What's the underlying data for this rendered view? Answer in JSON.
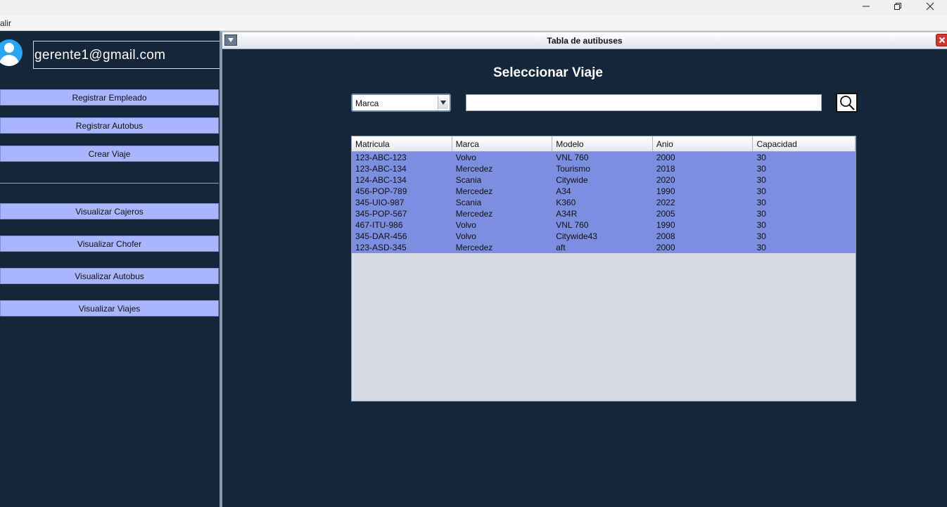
{
  "window": {
    "menu": [
      "alir"
    ]
  },
  "user": {
    "email": "gerente1@gmail.com"
  },
  "sidebar": {
    "buttons": [
      {
        "label": "Registrar Empleado"
      },
      {
        "label": "Registrar Autobus"
      },
      {
        "label": "Crear Viaje"
      },
      {
        "label": "Visualizar Cajeros"
      },
      {
        "label": "Visualizar Chofer"
      },
      {
        "label": "Visualizar Autobus"
      },
      {
        "label": "Visualizar Viajes"
      }
    ]
  },
  "frame": {
    "title": "Tabla de autibuses",
    "heading": "Seleccionar Viaje",
    "filter": {
      "selected": "Marca"
    },
    "search": {
      "value": ""
    }
  },
  "table": {
    "columns": [
      "Matricula",
      "Marca",
      "Modelo",
      "Anio",
      "Capacidad"
    ],
    "rows": [
      [
        "123-ABC-123",
        "Volvo",
        "VNL 760",
        "2000",
        "30"
      ],
      [
        "123-ABC-134",
        "Mercedez",
        "Tourismo",
        "2018",
        "30"
      ],
      [
        "124-ABC-134",
        "Scania",
        "Citywide",
        "2020",
        "30"
      ],
      [
        "456-POP-789",
        "Mercedez",
        "A34",
        "1990",
        "30"
      ],
      [
        "345-UIO-987",
        "Scania",
        "K360",
        "2022",
        "30"
      ],
      [
        "345-POP-567",
        "Mercedez",
        "A34R",
        "2005",
        "30"
      ],
      [
        "467-ITU-986",
        "Volvo",
        "VNL 760",
        "1990",
        "30"
      ],
      [
        "345-DAR-456",
        "Volvo",
        "Citywide43",
        "2008",
        "30"
      ],
      [
        "123-ASD-345",
        "Mercedez",
        "aft",
        "2000",
        "30"
      ]
    ]
  },
  "colors": {
    "background": "#13263a",
    "button": "#a8b6ff",
    "row_selected": "#7b8ee0",
    "close": "#d3332c"
  },
  "icons": {
    "minimize": "minimize-icon",
    "maximize": "restore-icon",
    "close": "close-icon",
    "avatar": "user-avatar-icon",
    "search": "search-icon",
    "dropdown": "chevron-down-icon"
  }
}
